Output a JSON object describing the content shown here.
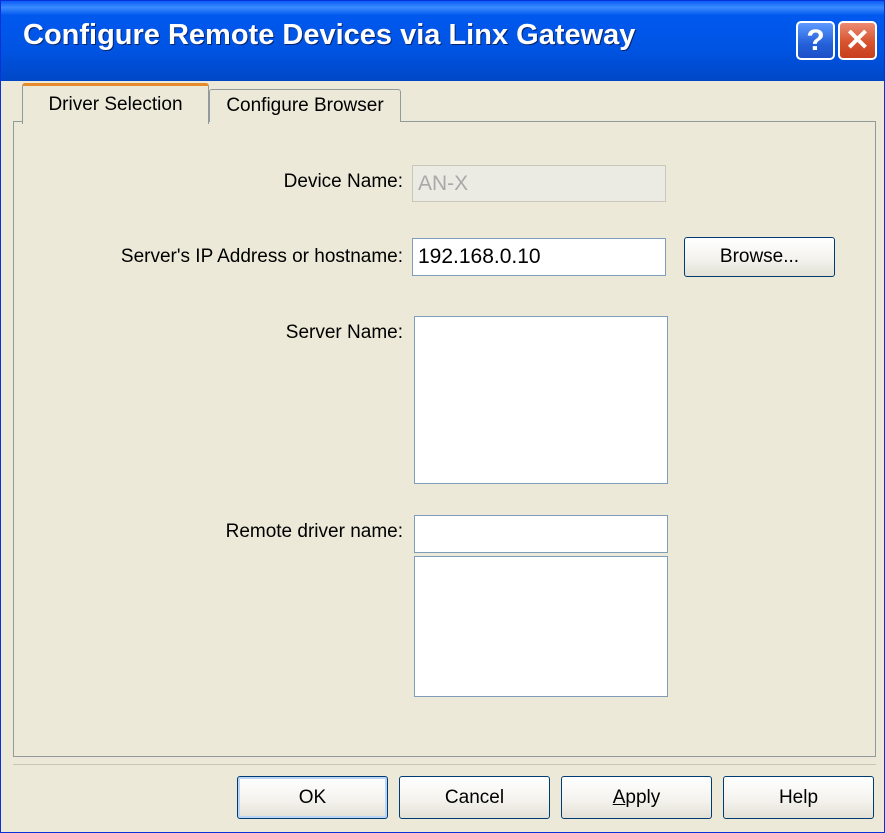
{
  "window": {
    "title": "Configure Remote Devices via Linx Gateway",
    "help_glyph": "?",
    "close_glyph": "✕"
  },
  "tabs": [
    {
      "label": "Driver Selection",
      "active": true
    },
    {
      "label": "Configure Browser",
      "active": false
    }
  ],
  "form": {
    "device_name_label": "Device Name:",
    "device_name_value": "AN-X",
    "server_ip_label": "Server's IP Address or hostname:",
    "server_ip_value": "192.168.0.10",
    "browse_label": "Browse...",
    "server_name_label": "Server Name:",
    "remote_driver_label": "Remote driver name:",
    "remote_driver_value": ""
  },
  "buttons": {
    "ok": "OK",
    "cancel": "Cancel",
    "apply_first": "A",
    "apply_rest": "pply",
    "help": "Help"
  },
  "colors": {
    "titlebar": "#0054e3",
    "tab_highlight": "#e68b2c",
    "dialog_bg": "#ece9d8"
  }
}
